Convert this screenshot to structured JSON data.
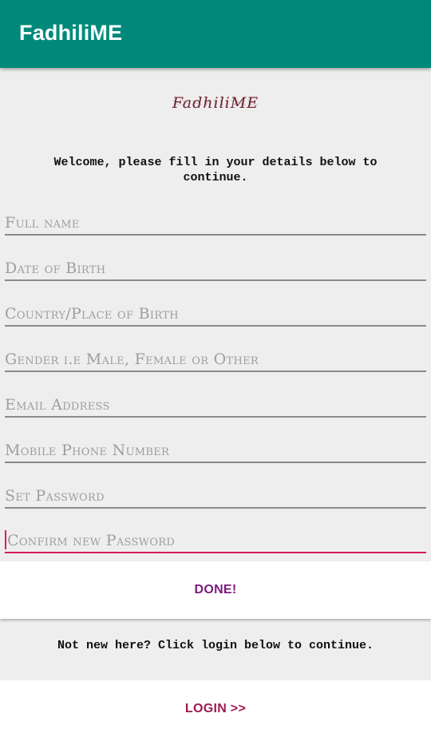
{
  "app_bar": {
    "title": "FadhiliME"
  },
  "logo": {
    "text": "FadhiliME"
  },
  "welcome_text": "Welcome, please fill in your details below to continue.",
  "form": {
    "fields": [
      {
        "placeholder": "Full name",
        "value": ""
      },
      {
        "placeholder": "Date of Birth",
        "value": ""
      },
      {
        "placeholder": "Country/Place of Birth",
        "value": ""
      },
      {
        "placeholder": "Gender i.e Male, Female or Other",
        "value": ""
      },
      {
        "placeholder": "Email Address",
        "value": ""
      },
      {
        "placeholder": "Mobile Phone Number",
        "value": ""
      },
      {
        "placeholder": "Set Password",
        "value": ""
      },
      {
        "placeholder": "Confirm new Password",
        "value": ""
      }
    ],
    "done_label": "DONE!"
  },
  "login_prompt": "Not new here? Click login below to continue.",
  "login_label": "LOGIN >>",
  "colors": {
    "app_bar": "#00897b",
    "focus_accent": "#d81b60",
    "done_text": "#7b1a7e",
    "login_text": "#9c1b4e"
  }
}
